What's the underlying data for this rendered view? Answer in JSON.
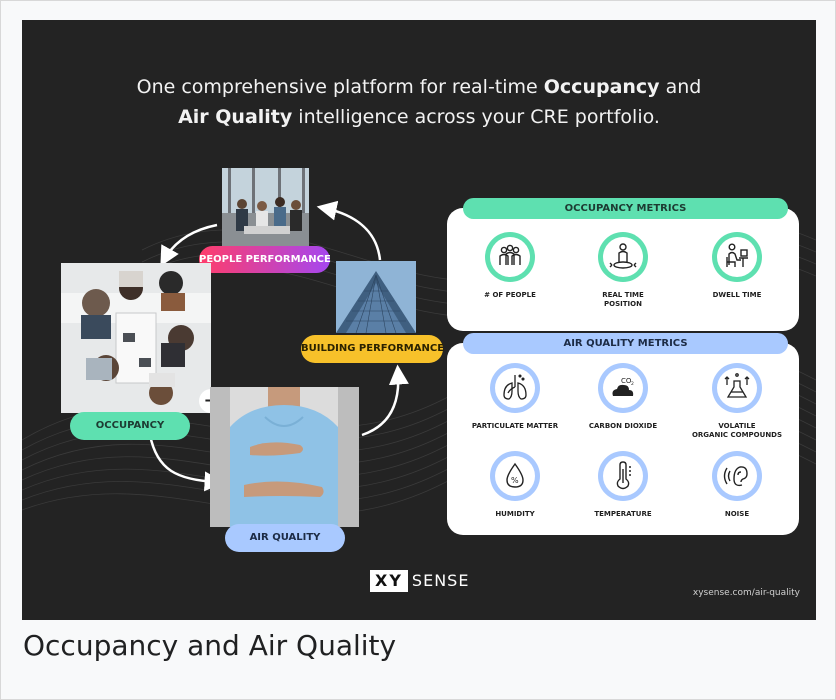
{
  "headline": {
    "line1_prefix": "One comprehensive platform for real-time ",
    "line1_bold": "Occupancy",
    "line1_suffix": " and",
    "line2_bold": "Air Quality",
    "line2_suffix": " intelligence across your CRE portfolio."
  },
  "cycle": {
    "people_performance": "PEOPLE PERFORMANCE",
    "building_performance": "BUILDING PERFORMANCE",
    "occupancy": "OCCUPANCY",
    "air_quality": "AIR QUALITY",
    "plus": "+"
  },
  "occupancy_metrics": {
    "title": "OCCUPANCY METRICS",
    "items": [
      {
        "label": "# OF PEOPLE",
        "icon": "people-group-icon"
      },
      {
        "label": "REAL TIME\nPOSITION",
        "icon": "person-position-icon"
      },
      {
        "label": "DWELL TIME",
        "icon": "person-at-desk-icon"
      }
    ]
  },
  "air_quality_metrics": {
    "title": "AIR QUALITY METRICS",
    "items": [
      {
        "label": "PARTICULATE MATTER",
        "icon": "lungs-icon"
      },
      {
        "label": "CARBON DIOXIDE",
        "icon": "co2-cloud-icon"
      },
      {
        "label": "VOLATILE\nORGANIC COMPOUNDS",
        "icon": "voc-flask-icon"
      },
      {
        "label": "HUMIDITY",
        "icon": "humidity-drop-icon"
      },
      {
        "label": "TEMPERATURE",
        "icon": "thermometer-icon"
      },
      {
        "label": "NOISE",
        "icon": "ear-sound-icon"
      }
    ]
  },
  "brand": {
    "logo_xy": "XY",
    "logo_sense": "SENSE",
    "url": "xysense.com/air-quality"
  },
  "caption": "Occupancy and Air Quality",
  "colors": {
    "background": "#232323",
    "occupancy_green": "#5ee0b0",
    "air_blue": "#a9c9ff",
    "building_yellow": "#f7c12a",
    "people_gradient_start": "#ff3d6a",
    "people_gradient_end": "#a547f0"
  }
}
